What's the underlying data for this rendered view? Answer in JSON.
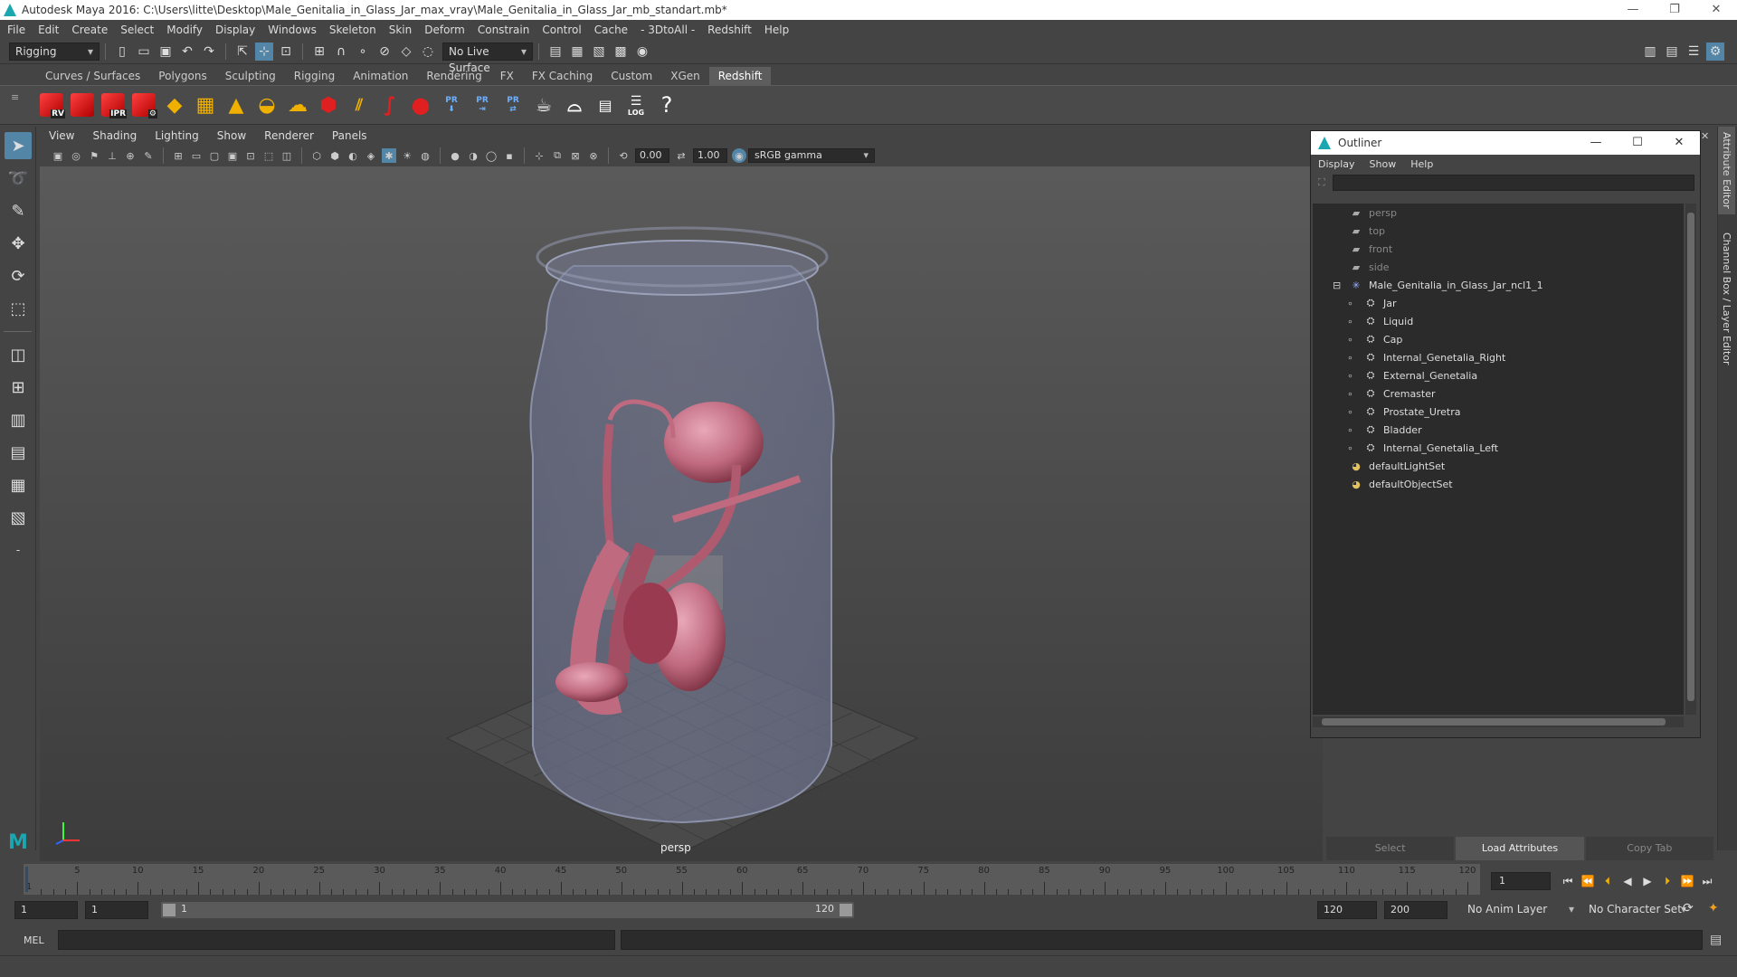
{
  "window": {
    "title": "Autodesk Maya 2016: C:\\Users\\litte\\Desktop\\Male_Genitalia_in_Glass_Jar_max_vray\\Male_Genitalia_in_Glass_Jar_mb_standart.mb*",
    "controls": [
      "—",
      "❐",
      "✕"
    ]
  },
  "menubar": [
    "File",
    "Edit",
    "Create",
    "Select",
    "Modify",
    "Display",
    "Windows",
    "Skeleton",
    "Skin",
    "Deform",
    "Constrain",
    "Control",
    "Cache",
    "- 3DtoAll -",
    "Redshift",
    "Help"
  ],
  "statusline": {
    "mode": "Rigging",
    "live_surface": "No Live Surface"
  },
  "shelf_tabs": [
    "Curves / Surfaces",
    "Polygons",
    "Sculpting",
    "Rigging",
    "Animation",
    "Rendering",
    "FX",
    "FX Caching",
    "Custom",
    "XGen",
    "Redshift"
  ],
  "shelf_tabs_active": "Redshift",
  "shelf_labels": {
    "rv": "RV",
    "ipr": "IPR",
    "pr1": "PR",
    "pr2": "PR",
    "pr3": "PR",
    "log": "LOG",
    "help": "?"
  },
  "panel_menu": [
    "View",
    "Shading",
    "Lighting",
    "Show",
    "Renderer",
    "Panels"
  ],
  "panel_toolbar": {
    "exposure": "0.00",
    "gamma": "1.00",
    "color_space": "sRGB gamma"
  },
  "viewport": {
    "camera_label": "persp"
  },
  "outliner": {
    "title": "Outliner",
    "menu": [
      "Display",
      "Show",
      "Help"
    ],
    "items": [
      {
        "name": "persp",
        "icon": "camera-icon",
        "level": 0,
        "dim": true
      },
      {
        "name": "top",
        "icon": "camera-icon",
        "level": 0,
        "dim": true
      },
      {
        "name": "front",
        "icon": "camera-icon",
        "level": 0,
        "dim": true
      },
      {
        "name": "side",
        "icon": "camera-icon",
        "level": 0,
        "dim": true
      },
      {
        "name": "Male_Genitalia_in_Glass_Jar_ncl1_1",
        "icon": "group-icon",
        "level": 0,
        "dim": false,
        "expanded": true
      },
      {
        "name": "Jar",
        "icon": "mesh-icon",
        "level": 1,
        "dim": false
      },
      {
        "name": "Liquid",
        "icon": "mesh-icon",
        "level": 1,
        "dim": false
      },
      {
        "name": "Cap",
        "icon": "mesh-icon",
        "level": 1,
        "dim": false
      },
      {
        "name": "Internal_Genetalia_Right",
        "icon": "mesh-icon",
        "level": 1,
        "dim": false
      },
      {
        "name": "External_Genetalia",
        "icon": "mesh-icon",
        "level": 1,
        "dim": false
      },
      {
        "name": "Cremaster",
        "icon": "mesh-icon",
        "level": 1,
        "dim": false
      },
      {
        "name": "Prostate_Uretra",
        "icon": "mesh-icon",
        "level": 1,
        "dim": false
      },
      {
        "name": "Bladder",
        "icon": "mesh-icon",
        "level": 1,
        "dim": false
      },
      {
        "name": "Internal_Genetalia_Left",
        "icon": "mesh-icon",
        "level": 1,
        "dim": false
      },
      {
        "name": "defaultLightSet",
        "icon": "set-icon",
        "level": 0,
        "dim": false
      },
      {
        "name": "defaultObjectSet",
        "icon": "set-icon",
        "level": 0,
        "dim": false
      }
    ]
  },
  "attribute_tabs": [
    "Attribute Editor",
    "Channel Box / Layer Editor"
  ],
  "attribute_buttons": [
    "Select",
    "Load Attributes",
    "Copy Tab"
  ],
  "timeline": {
    "ticks": [
      5,
      10,
      15,
      20,
      25,
      30,
      35,
      40,
      45,
      50,
      55,
      60,
      65,
      70,
      75,
      80,
      85,
      90,
      95,
      100,
      105,
      110,
      115,
      120
    ],
    "min": 1,
    "max": 120,
    "current": "1",
    "first_label": "1"
  },
  "range": {
    "start": "1",
    "playback_start": "1",
    "slider_start": "1",
    "slider_end": "120",
    "playback_end": "120",
    "end": "200",
    "anim_layer": "No Anim Layer",
    "character_set": "No Character Set"
  },
  "cmdline": {
    "label": "MEL"
  },
  "colors": {
    "accent": "#5285a6",
    "shelf_red": "#e02020",
    "maya_teal": "#1aa7b0"
  }
}
